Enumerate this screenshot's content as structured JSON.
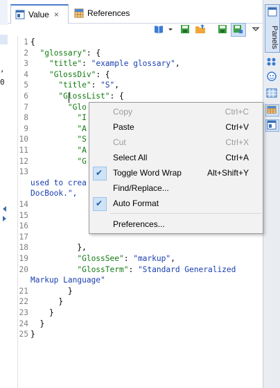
{
  "tabs": [
    {
      "label": "Value",
      "close": "×"
    },
    {
      "label": "References"
    }
  ],
  "left_strip_fragments": [
    ",",
    "0"
  ],
  "code": {
    "lines": [
      {
        "n": "1",
        "segments": [
          {
            "t": "{",
            "c": "p"
          }
        ]
      },
      {
        "n": "2",
        "segments": [
          {
            "t": "  ",
            "c": "p"
          },
          {
            "t": "\"glossary\"",
            "c": "k"
          },
          {
            "t": ": {",
            "c": "p"
          }
        ]
      },
      {
        "n": "3",
        "segments": [
          {
            "t": "    ",
            "c": "p"
          },
          {
            "t": "\"title\"",
            "c": "k"
          },
          {
            "t": ": ",
            "c": "p"
          },
          {
            "t": "\"example glossary\"",
            "c": "s"
          },
          {
            "t": ",",
            "c": "p"
          }
        ]
      },
      {
        "n": "4",
        "segments": [
          {
            "t": "    ",
            "c": "p"
          },
          {
            "t": "\"GlossDiv\"",
            "c": "k"
          },
          {
            "t": ": {",
            "c": "p"
          }
        ]
      },
      {
        "n": "5",
        "segments": [
          {
            "t": "      ",
            "c": "p"
          },
          {
            "t": "\"title\"",
            "c": "k"
          },
          {
            "t": ": ",
            "c": "p"
          },
          {
            "t": "\"S\"",
            "c": "s"
          },
          {
            "t": ",",
            "c": "p"
          }
        ]
      },
      {
        "n": "6",
        "segments": [
          {
            "t": "      ",
            "c": "p"
          },
          {
            "t": "\"GlossList\"",
            "c": "k"
          },
          {
            "t": ": {",
            "c": "p"
          }
        ]
      },
      {
        "n": "7",
        "segments": [
          {
            "t": "        ",
            "c": "p"
          },
          {
            "t": "\"Glo",
            "c": "k"
          }
        ]
      },
      {
        "n": "8",
        "segments": [
          {
            "t": "          ",
            "c": "p"
          },
          {
            "t": "\"I",
            "c": "k"
          }
        ]
      },
      {
        "n": "9",
        "segments": [
          {
            "t": "          ",
            "c": "p"
          },
          {
            "t": "\"A",
            "c": "k"
          }
        ]
      },
      {
        "n": "10",
        "segments": [
          {
            "t": "          ",
            "c": "p"
          },
          {
            "t": "\"S",
            "c": "k"
          }
        ]
      },
      {
        "n": "11",
        "segments": [
          {
            "t": "          ",
            "c": "p"
          },
          {
            "t": "\"A",
            "c": "k"
          }
        ]
      },
      {
        "n": "12",
        "segments": [
          {
            "t": "          ",
            "c": "p"
          },
          {
            "t": "\"G",
            "c": "k"
          }
        ]
      },
      {
        "n": "13",
        "segments": []
      },
      {
        "n": "",
        "wrap": true,
        "segments": [
          {
            "t": "used to crea",
            "c": "s"
          }
        ]
      },
      {
        "n": "",
        "wrap": true,
        "segments": [
          {
            "t": "DocBook.\",",
            "c": "s"
          }
        ]
      },
      {
        "n": "14",
        "segments": []
      },
      {
        "n": "15",
        "segments": []
      },
      {
        "n": "16",
        "segments": []
      },
      {
        "n": "17",
        "segments": []
      },
      {
        "n": "18",
        "segments": [
          {
            "t": "          },",
            "c": "p"
          }
        ]
      },
      {
        "n": "19",
        "segments": [
          {
            "t": "          ",
            "c": "p"
          },
          {
            "t": "\"GlossSee\"",
            "c": "k"
          },
          {
            "t": ": ",
            "c": "p"
          },
          {
            "t": "\"markup\"",
            "c": "s"
          },
          {
            "t": ",",
            "c": "p"
          }
        ]
      },
      {
        "n": "20",
        "segments": [
          {
            "t": "          ",
            "c": "p"
          },
          {
            "t": "\"GlossTerm\"",
            "c": "k"
          },
          {
            "t": ": ",
            "c": "p"
          },
          {
            "t": "\"Standard Generalized",
            "c": "s"
          }
        ]
      },
      {
        "n": "",
        "wrap": true,
        "segments": [
          {
            "t": "Markup Language\"",
            "c": "s"
          }
        ]
      },
      {
        "n": "21",
        "segments": [
          {
            "t": "        }",
            "c": "p"
          }
        ]
      },
      {
        "n": "22",
        "segments": [
          {
            "t": "      }",
            "c": "p"
          }
        ]
      },
      {
        "n": "23",
        "segments": [
          {
            "t": "    }",
            "c": "p"
          }
        ]
      },
      {
        "n": "24",
        "segments": [
          {
            "t": "  }",
            "c": "p"
          }
        ]
      },
      {
        "n": "25",
        "segments": [
          {
            "t": "}",
            "c": "p"
          }
        ]
      }
    ]
  },
  "context_menu": {
    "items": [
      {
        "label": "Copy",
        "accelerator": "Ctrl+C",
        "enabled": false,
        "checked": false
      },
      {
        "label": "Paste",
        "accelerator": "Ctrl+V",
        "enabled": true,
        "checked": false
      },
      {
        "label": "Cut",
        "accelerator": "Ctrl+X",
        "enabled": false,
        "checked": false
      },
      {
        "label": "Select All",
        "accelerator": "Ctrl+A",
        "enabled": true,
        "checked": false
      },
      {
        "label": "Toggle Word Wrap",
        "accelerator": "Alt+Shift+Y",
        "enabled": true,
        "checked": true
      },
      {
        "label": "Find/Replace...",
        "accelerator": "",
        "enabled": true,
        "checked": false
      },
      {
        "label": "Auto Format",
        "accelerator": "",
        "enabled": true,
        "checked": true
      },
      {
        "label": "Preferences...",
        "accelerator": "",
        "enabled": true,
        "checked": false
      }
    ],
    "check_glyph": "✔"
  },
  "right_trim": {
    "panels_label": "Panels"
  },
  "colors": {
    "json_key": "#117a11",
    "json_string": "#1a3fb0",
    "accent": "#4a7bd0",
    "menu_bg": "#f2f2f2",
    "check_bg": "#cfe3f7"
  }
}
